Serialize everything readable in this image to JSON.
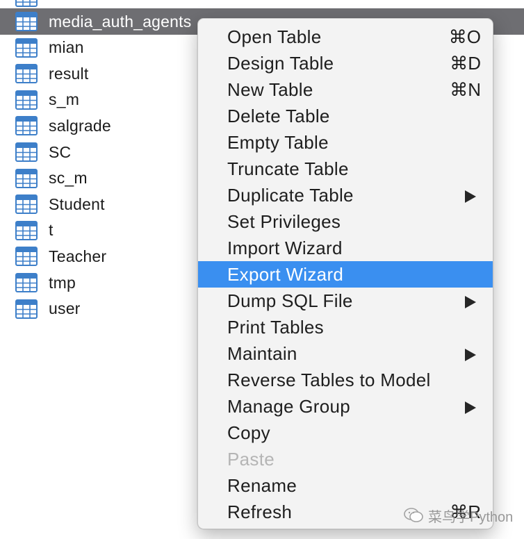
{
  "table_list": {
    "items": [
      {
        "label": "",
        "partial": true
      },
      {
        "label": "media_auth_agents",
        "selected": true
      },
      {
        "label": "mian"
      },
      {
        "label": "result"
      },
      {
        "label": "s_m"
      },
      {
        "label": "salgrade"
      },
      {
        "label": "SC"
      },
      {
        "label": "sc_m"
      },
      {
        "label": "Student"
      },
      {
        "label": "t"
      },
      {
        "label": "Teacher"
      },
      {
        "label": "tmp"
      },
      {
        "label": "user"
      }
    ]
  },
  "context_menu": {
    "items": [
      {
        "label": "Open Table",
        "shortcut": "⌘O"
      },
      {
        "label": "Design Table",
        "shortcut": "⌘D"
      },
      {
        "label": "New Table",
        "shortcut": "⌘N"
      },
      {
        "label": "Delete Table"
      },
      {
        "label": "Empty Table"
      },
      {
        "label": "Truncate Table"
      },
      {
        "label": "Duplicate Table",
        "submenu": true
      },
      {
        "label": "Set Privileges"
      },
      {
        "label": "Import Wizard"
      },
      {
        "label": "Export Wizard",
        "highlighted": true
      },
      {
        "label": "Dump SQL File",
        "submenu": true
      },
      {
        "label": "Print Tables"
      },
      {
        "label": "Maintain",
        "submenu": true
      },
      {
        "label": "Reverse Tables to Model"
      },
      {
        "label": "Manage Group",
        "submenu": true
      },
      {
        "label": "Copy"
      },
      {
        "label": "Paste",
        "disabled": true
      },
      {
        "label": "Rename"
      },
      {
        "label": "Refresh",
        "shortcut": "⌘R"
      }
    ]
  },
  "watermark": {
    "text": "菜鸟学Python"
  },
  "colors": {
    "selection_gray": "#6e6e72",
    "highlight_blue": "#3a8ff0",
    "icon_blue": "#3d7fc9"
  }
}
